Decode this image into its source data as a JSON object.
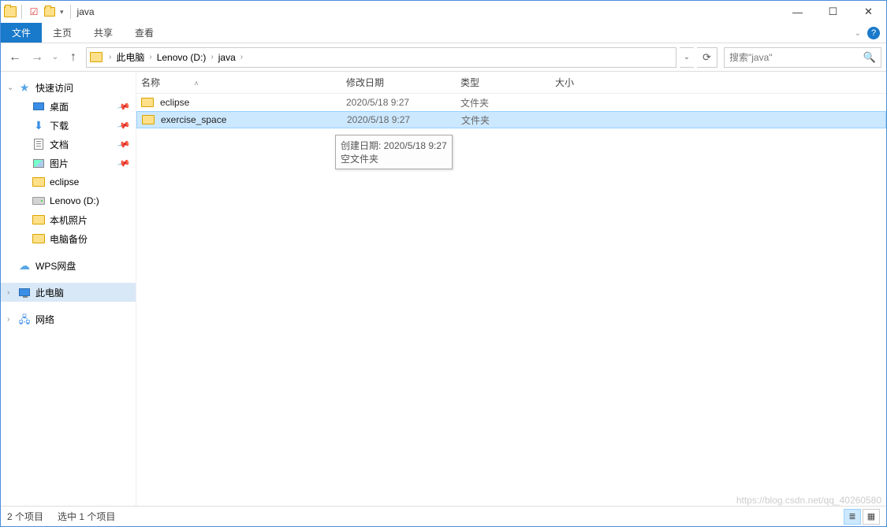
{
  "window": {
    "title": "java"
  },
  "ribbon": {
    "file": "文件",
    "home": "主页",
    "share": "共享",
    "view": "查看"
  },
  "breadcrumb": {
    "root": "此电脑",
    "drive": "Lenovo (D:)",
    "folder": "java"
  },
  "search": {
    "placeholder": "搜索\"java\""
  },
  "sidebar": {
    "quick_access": "快速访问",
    "desktop": "桌面",
    "downloads": "下载",
    "documents": "文档",
    "pictures": "图片",
    "eclipse": "eclipse",
    "drive_d": "Lenovo (D:)",
    "local_photos": "本机照片",
    "pc_backup": "电脑备份",
    "wps": "WPS网盘",
    "this_pc": "此电脑",
    "network": "网络"
  },
  "columns": {
    "name": "名称",
    "date": "修改日期",
    "type": "类型",
    "size": "大小"
  },
  "rows": [
    {
      "name": "eclipse",
      "date": "2020/5/18 9:27",
      "type": "文件夹",
      "selected": false
    },
    {
      "name": "exercise_space",
      "date": "2020/5/18 9:27",
      "type": "文件夹",
      "selected": true
    }
  ],
  "tooltip": {
    "line1": "创建日期: 2020/5/18 9:27",
    "line2": "空文件夹"
  },
  "status": {
    "count": "2 个项目",
    "selected": "选中 1 个项目"
  },
  "watermark": "https://blog.csdn.net/qq_40260580"
}
